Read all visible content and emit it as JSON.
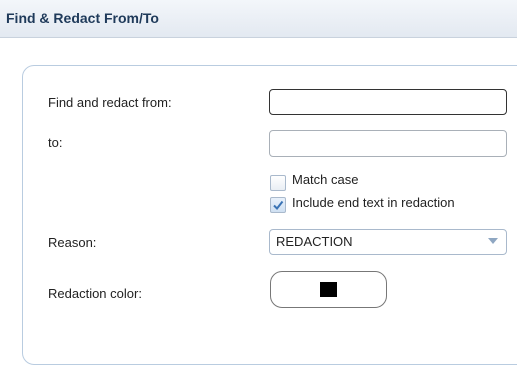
{
  "dialog": {
    "title": "Find & Redact From/To"
  },
  "form": {
    "find_from_label": "Find and redact from:",
    "find_from_value": "",
    "to_label": "to:",
    "to_value": "",
    "match_case": {
      "label": "Match case",
      "checked": false
    },
    "include_end_text": {
      "label": "Include end text in redaction",
      "checked": true
    },
    "reason_label": "Reason:",
    "reason_value": "REDACTION",
    "color_label": "Redaction color:",
    "redaction_color": "#000000"
  },
  "icons": {
    "checkbox_check": "check-icon",
    "dropdown_arrow": "chevron-down-icon"
  }
}
